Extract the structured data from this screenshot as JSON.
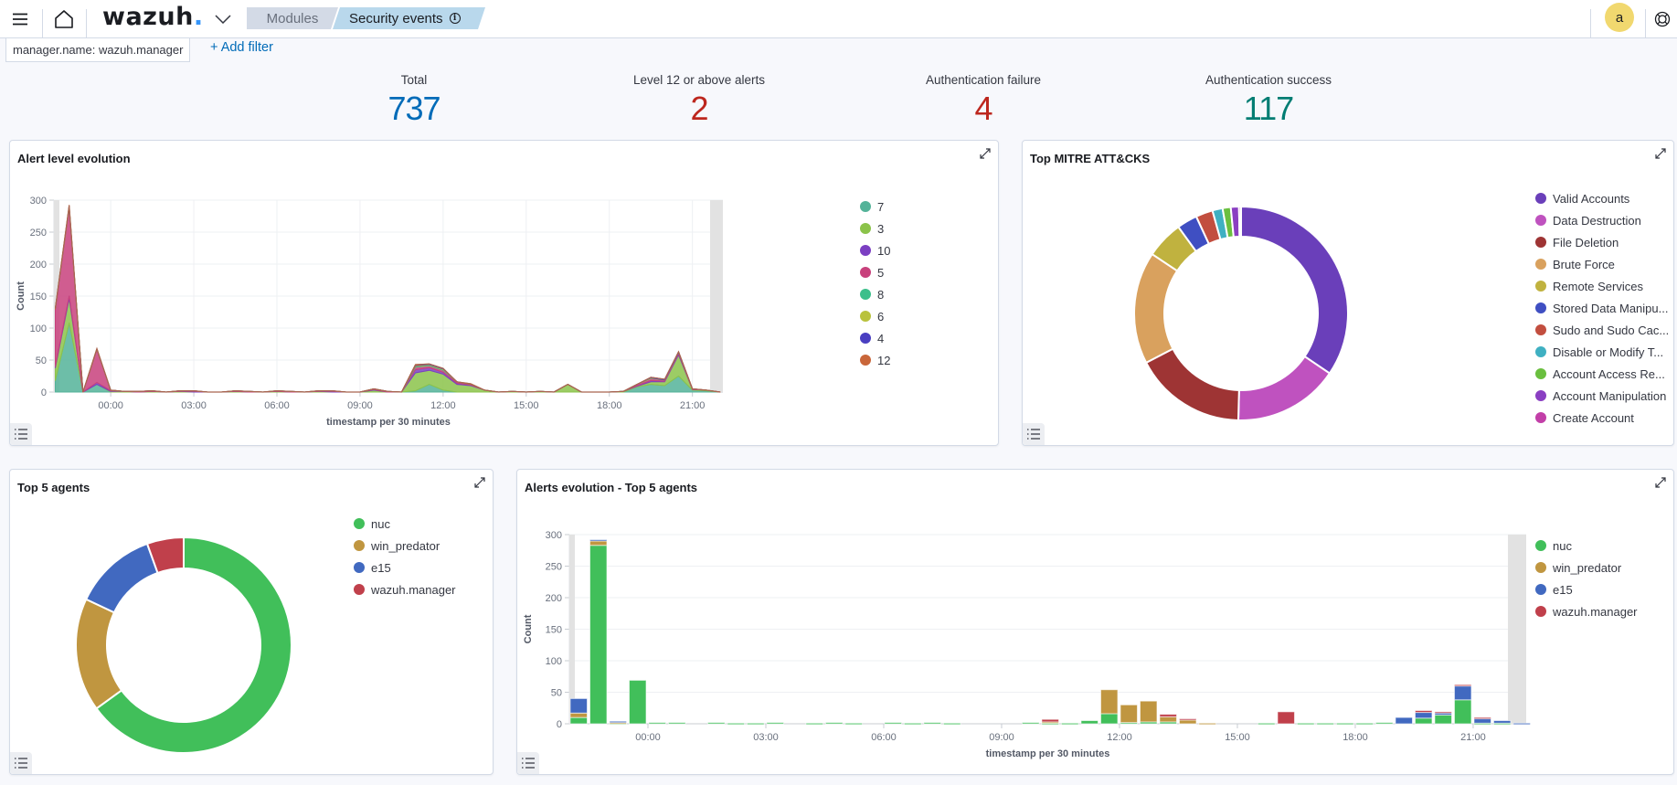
{
  "header": {
    "logo_text": "wazuh",
    "logo_dot": ".",
    "breadcrumbs": [
      {
        "label": "Modules"
      },
      {
        "label": "Security events",
        "icon": "info-icon"
      }
    ],
    "avatar_initial": "a",
    "icons": [
      "menu-icon",
      "home-icon",
      "chevron-down-icon",
      "help-icon"
    ]
  },
  "filters": {
    "pill": "manager.name: wazuh.manager",
    "add_filter": "+ Add filter"
  },
  "stats": [
    {
      "label": "Total",
      "value": "737",
      "color": "#006bb8"
    },
    {
      "label": "Level 12 or above alerts",
      "value": "2",
      "color": "#bd271e"
    },
    {
      "label": "Authentication failure",
      "value": "4",
      "color": "#bd271e"
    },
    {
      "label": "Authentication success",
      "value": "117",
      "color": "#017d73"
    }
  ],
  "panels": {
    "alert_level": {
      "title": "Alert level evolution"
    },
    "mitre": {
      "title": "Top MITRE ATT&CKS"
    },
    "top_agents": {
      "title": "Top 5 agents"
    },
    "alerts_evolution": {
      "title": "Alerts evolution - Top 5 agents"
    }
  },
  "chart_data": [
    {
      "id": "alert_level",
      "type": "area",
      "stacked": true,
      "title": "Alert level evolution",
      "xlabel": "timestamp per 30 minutes",
      "ylabel": "Count",
      "ylim": [
        0,
        300
      ],
      "yticks": [
        0,
        50,
        100,
        150,
        200,
        250,
        300
      ],
      "xtick_labels": [
        "00:00",
        "03:00",
        "06:00",
        "09:00",
        "12:00",
        "15:00",
        "18:00",
        "21:00"
      ],
      "x_hours": [
        -2.0,
        -1.5,
        -1.0,
        -0.5,
        0.0,
        0.5,
        1.0,
        1.5,
        2.0,
        2.5,
        3.0,
        3.5,
        4.0,
        4.5,
        5.0,
        5.5,
        6.0,
        6.5,
        7.0,
        7.5,
        8.0,
        8.5,
        9.0,
        9.5,
        10.0,
        10.5,
        11.0,
        11.5,
        12.0,
        12.5,
        13.0,
        13.5,
        14.0,
        14.5,
        15.0,
        15.5,
        16.0,
        16.5,
        17.0,
        17.5,
        18.0,
        18.5,
        19.0,
        19.5,
        20.0,
        20.5,
        21.0,
        21.5,
        22.0
      ],
      "series": [
        {
          "name": "7",
          "color": "#54b399",
          "values": [
            18,
            108,
            0,
            12,
            0,
            0,
            0,
            0,
            0,
            0,
            0,
            0,
            0,
            0,
            0,
            0,
            0,
            0,
            0,
            0,
            0,
            0,
            0,
            0,
            0,
            0,
            2,
            12,
            3,
            0,
            0,
            0,
            0,
            0,
            0,
            0,
            0,
            0,
            0,
            0,
            0,
            0,
            8,
            12,
            10,
            25,
            3,
            2,
            0
          ]
        },
        {
          "name": "3",
          "color": "#8bc34a",
          "values": [
            20,
            38,
            0,
            0,
            1,
            1,
            0,
            1,
            0,
            1,
            0,
            0,
            0,
            1,
            0,
            0,
            1,
            0,
            0,
            1,
            0,
            0,
            0,
            3,
            0,
            0,
            28,
            22,
            25,
            12,
            10,
            3,
            0,
            1,
            0,
            1,
            0,
            12,
            0,
            0,
            0,
            1,
            1,
            4,
            6,
            33,
            1,
            1,
            0
          ]
        },
        {
          "name": "10",
          "color": "#7b3fc2",
          "values": [
            2,
            4,
            0,
            3,
            1,
            0,
            0,
            0,
            0,
            0,
            1,
            0,
            0,
            0,
            0,
            0,
            0,
            0,
            0,
            0,
            1,
            0,
            0,
            1,
            0,
            0,
            5,
            4,
            3,
            2,
            1,
            0,
            0,
            0,
            0,
            0,
            0,
            0,
            0,
            0,
            0,
            0,
            1,
            2,
            1,
            2,
            0,
            0,
            0
          ]
        },
        {
          "name": "5",
          "color": "#c8417c",
          "values": [
            90,
            140,
            0,
            52,
            1,
            0,
            1,
            1,
            0,
            1,
            1,
            0,
            0,
            1,
            1,
            0,
            1,
            1,
            0,
            1,
            1,
            0,
            0,
            1,
            1,
            0,
            4,
            3,
            3,
            2,
            1,
            0,
            0,
            0,
            0,
            0,
            0,
            0,
            0,
            0,
            0,
            0,
            2,
            3,
            2,
            2,
            1,
            0,
            0
          ]
        },
        {
          "name": "8",
          "color": "#3bbf8b",
          "values": [
            0,
            0,
            0,
            0,
            0,
            0,
            0,
            0,
            0,
            0,
            0,
            0,
            0,
            0,
            0,
            0,
            0,
            0,
            0,
            0,
            0,
            0,
            0,
            0,
            0,
            0,
            1,
            1,
            1,
            0,
            0,
            0,
            0,
            0,
            0,
            0,
            0,
            0,
            0,
            0,
            0,
            0,
            0,
            0,
            0,
            0,
            0,
            0,
            0
          ]
        },
        {
          "name": "6",
          "color": "#b9c23d",
          "values": [
            0,
            0,
            0,
            0,
            0,
            0,
            0,
            0,
            0,
            0,
            0,
            0,
            0,
            0,
            0,
            0,
            0,
            0,
            0,
            0,
            0,
            0,
            0,
            0,
            0,
            0,
            1,
            1,
            1,
            0,
            0,
            0,
            0,
            0,
            0,
            0,
            0,
            0,
            0,
            0,
            0,
            0,
            0,
            1,
            0,
            0,
            0,
            0,
            0
          ]
        },
        {
          "name": "4",
          "color": "#4a3fc1",
          "values": [
            0,
            0,
            0,
            0,
            0,
            0,
            0,
            0,
            0,
            0,
            0,
            0,
            0,
            0,
            0,
            0,
            0,
            0,
            0,
            0,
            0,
            0,
            0,
            0,
            0,
            0,
            1,
            1,
            1,
            0,
            0,
            0,
            0,
            0,
            0,
            0,
            0,
            0,
            0,
            0,
            0,
            0,
            0,
            1,
            1,
            1,
            0,
            0,
            0
          ]
        },
        {
          "name": "12",
          "color": "#c9663a",
          "values": [
            1,
            2,
            0,
            1,
            0,
            0,
            0,
            0,
            0,
            0,
            0,
            0,
            0,
            0,
            0,
            0,
            0,
            0,
            0,
            0,
            0,
            0,
            0,
            0,
            0,
            0,
            1,
            0,
            0,
            0,
            1,
            0,
            0,
            0,
            0,
            0,
            0,
            0,
            0,
            0,
            0,
            0,
            0,
            0,
            0,
            0,
            0,
            0,
            0
          ]
        }
      ],
      "legend": "right"
    },
    {
      "id": "mitre",
      "type": "pie",
      "donut": true,
      "title": "Top MITRE ATT&CKS",
      "legend": "right",
      "slices": [
        {
          "label": "Valid Accounts",
          "display": "Valid Accounts",
          "value": 33.5,
          "color": "#6a3fba"
        },
        {
          "label": "Data Destruction",
          "display": "Data Destruction",
          "value": 15.5,
          "color": "#bf52bf"
        },
        {
          "label": "File Deletion",
          "display": "File Deletion",
          "value": 16.5,
          "color": "#9e3434"
        },
        {
          "label": "Brute Force",
          "display": "Brute Force",
          "value": 16.5,
          "color": "#d9a15e"
        },
        {
          "label": "Remote Services",
          "display": "Remote Services",
          "value": 5.5,
          "color": "#c0b23f"
        },
        {
          "label": "Stored Data Manipulation",
          "display": "Stored Data Manipu...",
          "value": 3.0,
          "color": "#3f4fc2"
        },
        {
          "label": "Sudo and Sudo Caching",
          "display": "Sudo and Sudo Cac...",
          "value": 2.5,
          "color": "#c24e3f"
        },
        {
          "label": "Disable or Modify Tools",
          "display": "Disable or Modify T...",
          "value": 1.5,
          "color": "#3fb0c2"
        },
        {
          "label": "Account Access Removal",
          "display": "Account Access Re...",
          "value": 1.2,
          "color": "#6abf3f"
        },
        {
          "label": "Account Manipulation",
          "display": "Account Manipulation",
          "value": 1.2,
          "color": "#8a3fc2"
        },
        {
          "label": "Create Account",
          "display": "Create Account",
          "value": 0.3,
          "color": "#c23fa8"
        }
      ]
    },
    {
      "id": "top_agents",
      "type": "pie",
      "donut": true,
      "title": "Top 5 agents",
      "legend": "right",
      "slices": [
        {
          "label": "nuc",
          "value": 65,
          "color": "#41bf5a"
        },
        {
          "label": "win_predator",
          "value": 17,
          "color": "#c09640"
        },
        {
          "label": "e15",
          "value": 12.5,
          "color": "#4169c0"
        },
        {
          "label": "wazuh.manager",
          "value": 5.5,
          "color": "#c0404b"
        }
      ]
    },
    {
      "id": "alerts_evolution",
      "type": "bar",
      "stacked": true,
      "title": "Alerts evolution - Top 5 agents",
      "xlabel": "timestamp per 30 minutes",
      "ylabel": "Count",
      "ylim": [
        0,
        300
      ],
      "yticks": [
        0,
        50,
        100,
        150,
        200,
        250,
        300
      ],
      "xtick_labels": [
        "00:00",
        "03:00",
        "06:00",
        "09:00",
        "12:00",
        "15:00",
        "18:00",
        "21:00"
      ],
      "x_hours": [
        -2.0,
        -1.5,
        -1.0,
        -0.5,
        0.0,
        0.5,
        1.0,
        1.5,
        2.0,
        2.5,
        3.0,
        3.5,
        4.0,
        4.5,
        5.0,
        5.5,
        6.0,
        6.5,
        7.0,
        7.5,
        8.0,
        8.5,
        9.0,
        9.5,
        10.0,
        10.5,
        11.0,
        11.5,
        12.0,
        12.5,
        13.0,
        13.5,
        14.0,
        14.5,
        15.0,
        15.5,
        16.0,
        16.5,
        17.0,
        17.5,
        18.0,
        18.5,
        19.0,
        19.5,
        20.0,
        20.5,
        21.0,
        21.5,
        22.0
      ],
      "series": [
        {
          "name": "nuc",
          "color": "#41bf5a",
          "values": [
            10,
            283,
            1,
            69,
            2,
            2,
            0,
            2,
            1,
            1,
            2,
            0,
            1,
            2,
            1,
            0,
            2,
            1,
            2,
            1,
            0,
            0,
            0,
            2,
            1,
            1,
            5,
            16,
            2,
            3,
            3,
            0,
            0,
            0,
            0,
            1,
            0,
            1,
            1,
            1,
            1,
            2,
            0,
            9,
            14,
            38,
            1,
            1,
            0
          ]
        },
        {
          "name": "win_predator",
          "color": "#c09640",
          "values": [
            7,
            7,
            1,
            0,
            0,
            0,
            0,
            0,
            0,
            0,
            0,
            0,
            0,
            0,
            0,
            0,
            0,
            0,
            0,
            0,
            0,
            0,
            0,
            0,
            2,
            0,
            0,
            38,
            28,
            33,
            8,
            6,
            1,
            0,
            0,
            0,
            0,
            0,
            0,
            0,
            0,
            0,
            0,
            0,
            0,
            0,
            0,
            0,
            0
          ]
        },
        {
          "name": "e15",
          "color": "#4169c0",
          "values": [
            23,
            2,
            2,
            0,
            0,
            0,
            0,
            0,
            0,
            0,
            0,
            0,
            0,
            0,
            0,
            0,
            0,
            0,
            0,
            0,
            0,
            0,
            0,
            0,
            0,
            0,
            0,
            0,
            0,
            0,
            0,
            0,
            0,
            0,
            0,
            0,
            0,
            0,
            0,
            0,
            0,
            0,
            10,
            9,
            4,
            22,
            8,
            4,
            1
          ]
        },
        {
          "name": "wazuh.manager",
          "color": "#c0404b",
          "values": [
            0,
            0,
            0,
            0,
            0,
            0,
            0,
            0,
            0,
            0,
            0,
            0,
            0,
            0,
            0,
            0,
            0,
            0,
            0,
            0,
            0,
            0,
            0,
            0,
            4,
            0,
            0,
            0,
            0,
            0,
            4,
            2,
            0,
            0,
            0,
            0,
            19,
            0,
            0,
            0,
            0,
            0,
            0,
            3,
            1,
            2,
            1,
            0,
            0
          ]
        }
      ],
      "legend": "right"
    }
  ]
}
